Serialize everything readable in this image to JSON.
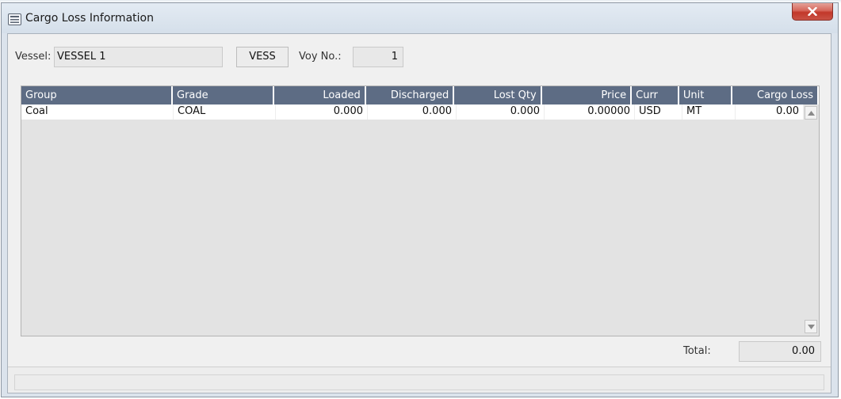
{
  "window": {
    "title": "Cargo Loss Information",
    "close_icon": "close-x-icon",
    "title_icon": "document-icon",
    "close_color": "#c8463a"
  },
  "header": {
    "vessel_label": "Vessel:",
    "vessel_value": "VESSEL 1",
    "vessel_code": "VESS",
    "voy_label": "Voy No.:",
    "voy_value": "1"
  },
  "grid": {
    "header_color": "#5d6c84",
    "columns": [
      "Group",
      "Grade",
      "Loaded",
      "Discharged",
      "Lost Qty",
      "Price",
      "Curr",
      "Unit",
      "Cargo Loss"
    ],
    "rows": [
      {
        "group": "Coal",
        "grade": "COAL",
        "loaded": "0.000",
        "discharged": "0.000",
        "lost_qty": "0.000",
        "price": "0.00000",
        "curr": "USD",
        "unit": "MT",
        "cargo_loss": "0.00"
      }
    ]
  },
  "footer": {
    "total_label": "Total:",
    "total_value": "0.00"
  }
}
